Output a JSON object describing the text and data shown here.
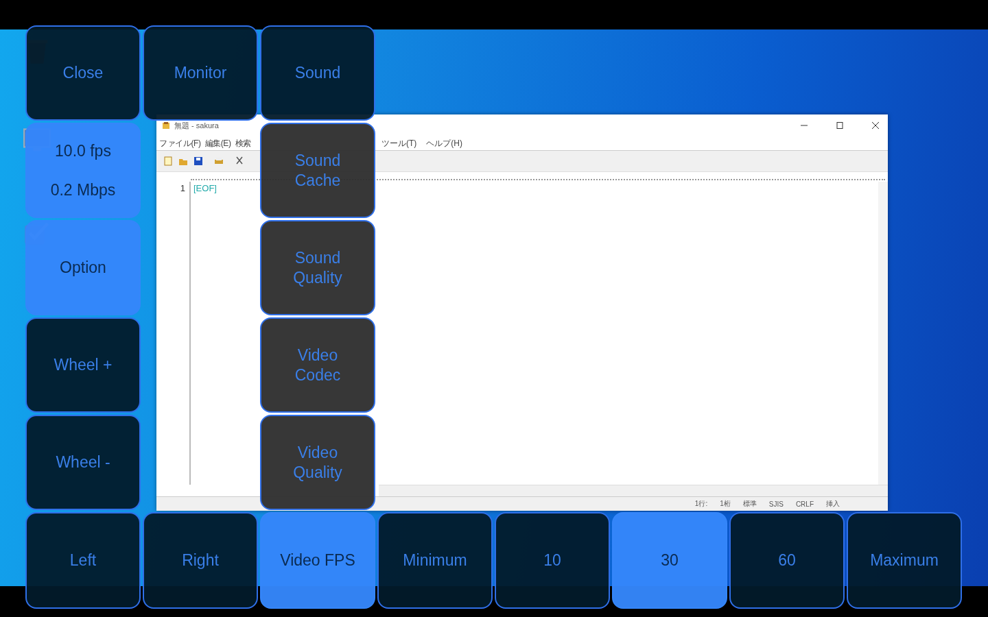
{
  "remote_window": {
    "title": "無題 - sakura",
    "menu_left": [
      "ファイル(F)",
      "編集(E)",
      "検索"
    ],
    "menu_right": [
      "ツール(T)",
      "ヘルプ(H)"
    ],
    "line_number": "1",
    "eof_mark": "[EOF]",
    "status_bar": [
      "1行:",
      "1桁",
      "標準",
      "SJIS",
      "CRLF",
      "挿入"
    ]
  },
  "overlay": {
    "left_column": [
      {
        "kind": "key",
        "label": "Close",
        "selected": false
      },
      {
        "kind": "stats",
        "fps": "10.0 fps",
        "bitrate": "0.2 Mbps"
      },
      {
        "kind": "key",
        "label": "Option",
        "selected": true
      },
      {
        "kind": "key",
        "label": "Wheel +",
        "selected": false
      },
      {
        "kind": "key",
        "label": "Wheel -",
        "selected": false
      }
    ],
    "middle_column": [
      {
        "kind": "key",
        "label": "Monitor",
        "selected": false
      }
    ],
    "option_column": [
      {
        "kind": "key",
        "label": "Sound",
        "selected": false
      },
      {
        "kind": "submenu",
        "label": "Sound Cache",
        "selected": false
      },
      {
        "kind": "submenu",
        "label": "Sound Quality",
        "selected": false
      },
      {
        "kind": "submenu",
        "label": "Video Codec",
        "selected": false
      },
      {
        "kind": "submenu",
        "label": "Video Quality",
        "selected": false
      }
    ],
    "bottom_row": [
      {
        "kind": "key",
        "label": "Left",
        "selected": false
      },
      {
        "kind": "key",
        "label": "Right",
        "selected": false
      },
      {
        "kind": "key",
        "label": "Video FPS",
        "selected": true
      },
      {
        "kind": "key",
        "label": "Minimum",
        "selected": false
      },
      {
        "kind": "key",
        "label": "10",
        "selected": false
      },
      {
        "kind": "key",
        "label": "30",
        "selected": true
      },
      {
        "kind": "key",
        "label": "60",
        "selected": false
      },
      {
        "kind": "key",
        "label": "Maximum",
        "selected": false
      }
    ]
  }
}
